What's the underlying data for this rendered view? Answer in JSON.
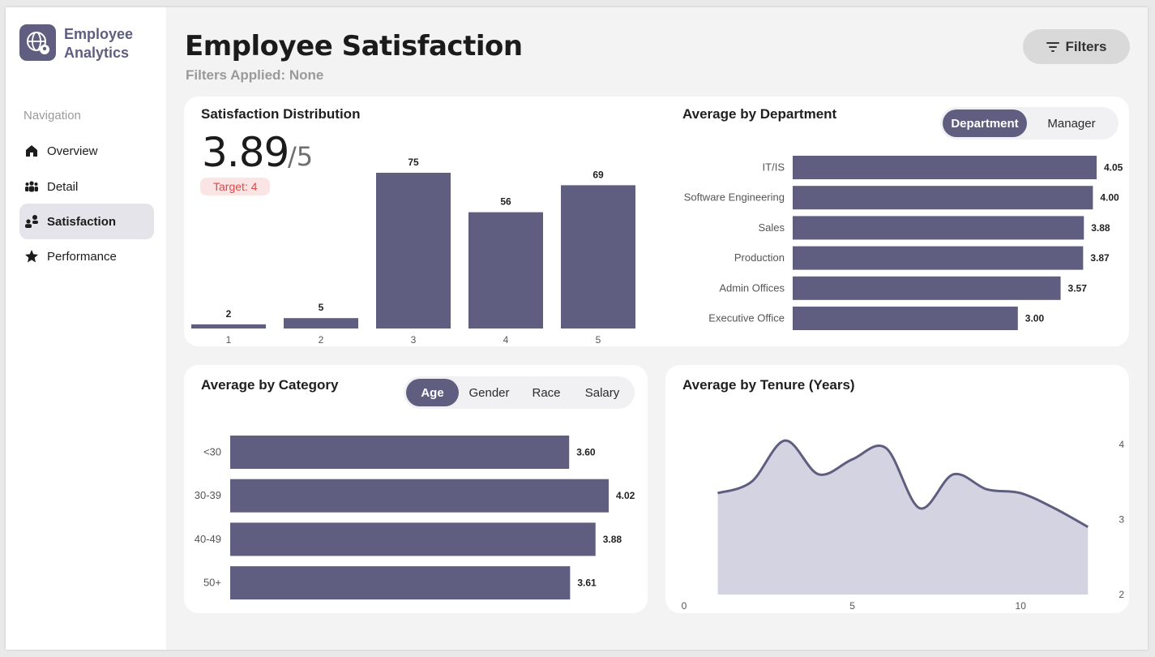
{
  "app": {
    "name": "Employee Analytics"
  },
  "sidebar": {
    "heading": "Navigation",
    "items": [
      {
        "label": "Overview",
        "icon": "home-icon",
        "active": false
      },
      {
        "label": "Detail",
        "icon": "people-group-icon",
        "active": false
      },
      {
        "label": "Satisfaction",
        "icon": "people-chat-icon",
        "active": true
      },
      {
        "label": "Performance",
        "icon": "star-icon",
        "active": false
      }
    ]
  },
  "header": {
    "title": "Employee Satisfaction",
    "subtitle": "Filters Applied: None",
    "filters_label": "Filters"
  },
  "colors": {
    "accent": "#5f5e80",
    "area_fill": "#d4d3e1",
    "target_bg": "#fbe4e4",
    "target_text": "#d94b4b"
  },
  "distribution": {
    "title": "Satisfaction Distribution",
    "kpi_value": "3.89",
    "kpi_denominator": "/5",
    "target_label": "Target: 4"
  },
  "department": {
    "title": "Average by Department",
    "toggle": [
      "Department",
      "Manager"
    ],
    "toggle_active": 0
  },
  "category": {
    "title": "Average by Category",
    "toggle": [
      "Age",
      "Gender",
      "Race",
      "Salary"
    ],
    "toggle_active": 0
  },
  "tenure": {
    "title": "Average by Tenure (Years)"
  },
  "chart_data": [
    {
      "id": "distribution",
      "type": "bar",
      "categories": [
        "1",
        "2",
        "3",
        "4",
        "5"
      ],
      "values": [
        2,
        5,
        75,
        56,
        69
      ],
      "ylim": [
        0,
        75
      ]
    },
    {
      "id": "department",
      "type": "bar",
      "orientation": "horizontal",
      "categories": [
        "IT/IS",
        "Software Engineering",
        "Sales",
        "Production",
        "Admin Offices",
        "Executive Office"
      ],
      "values": [
        4.05,
        4.0,
        3.88,
        3.87,
        3.57,
        3.0
      ],
      "value_labels": [
        "4.05",
        "4.00",
        "3.88",
        "3.87",
        "3.57",
        "3.00"
      ]
    },
    {
      "id": "category",
      "type": "bar",
      "orientation": "horizontal",
      "categories": [
        "<30",
        "30-39",
        "40-49",
        "50+"
      ],
      "values": [
        3.6,
        4.02,
        3.88,
        3.61
      ],
      "value_labels": [
        "3.60",
        "4.02",
        "3.88",
        "3.61"
      ]
    },
    {
      "id": "tenure",
      "type": "area",
      "x": [
        1,
        2,
        3,
        4,
        5,
        6,
        7,
        8,
        9,
        10,
        11,
        12
      ],
      "y": [
        3.35,
        3.5,
        4.05,
        3.6,
        3.8,
        3.95,
        3.15,
        3.6,
        3.4,
        3.35,
        3.15,
        2.9
      ],
      "xlim": [
        0,
        12.5
      ],
      "ylim": [
        2,
        4.3
      ],
      "xticks": [
        0,
        5,
        10
      ],
      "yticks": [
        2,
        3,
        4
      ],
      "y_axis_position": "right"
    }
  ]
}
